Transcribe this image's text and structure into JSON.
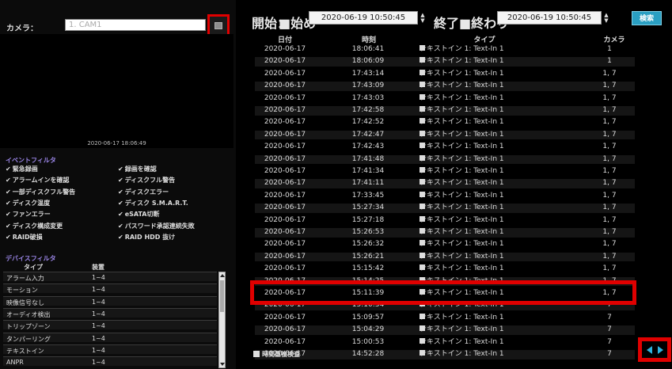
{
  "camera": {
    "label": "カメラ：",
    "value": "1. CAM1"
  },
  "video": {
    "timestamp": "2020-06-17  18:06:49"
  },
  "event_filter": {
    "title": "イベントフィルタ",
    "items": [
      "緊急録画",
      "録画を確認",
      "アラームインを確認",
      "ディスクフル警告",
      "一部ディスクフル警告",
      "ディスクエラー",
      "ディスク温度",
      "ディスク S.M.A.R.T.",
      "ファンエラー",
      "eSATA切断",
      "ディスク構成変更",
      "パスワード承認連続失敗",
      "RAID破損",
      "RAID HDD 抜け"
    ]
  },
  "device_filter": {
    "title": "デバイスフィルタ",
    "columns": [
      "タイプ",
      "装置"
    ],
    "rows": [
      [
        "アラーム入力",
        "1~4"
      ],
      [
        "モーション",
        "1~4"
      ],
      [
        "映像信号なし",
        "1~4"
      ],
      [
        "オーディオ検出",
        "1~4"
      ],
      [
        "トリップゾーン",
        "1~4"
      ],
      [
        "タンパーリング",
        "1~4"
      ],
      [
        "テキストイン",
        "1~4"
      ],
      [
        "ANPR",
        "1~4"
      ]
    ]
  },
  "toolbar": {
    "start_label": "開始：",
    "start_begin": "■始め",
    "start_value": "2020-06-19  10:50:45",
    "end_label": "終了：",
    "end_end": "■終わり",
    "end_value": "2020-06-19  10:50:45",
    "search_label": "検索"
  },
  "log": {
    "columns": [
      "日付",
      "時刻",
      "タイプ",
      "カメラ"
    ],
    "rows": [
      [
        "2020-06-17",
        "18:06:41",
        "テキストイン 1: Text-In 1",
        "1"
      ],
      [
        "2020-06-17",
        "18:06:09",
        "テキストイン 1: Text-In 1",
        "1"
      ],
      [
        "2020-06-17",
        "17:43:14",
        "テキストイン 1: Text-In 1",
        "1, 7"
      ],
      [
        "2020-06-17",
        "17:43:09",
        "テキストイン 1: Text-In 1",
        "1, 7"
      ],
      [
        "2020-06-17",
        "17:43:03",
        "テキストイン 1: Text-In 1",
        "1, 7"
      ],
      [
        "2020-06-17",
        "17:42:58",
        "テキストイン 1: Text-In 1",
        "1, 7"
      ],
      [
        "2020-06-17",
        "17:42:52",
        "テキストイン 1: Text-In 1",
        "1, 7"
      ],
      [
        "2020-06-17",
        "17:42:47",
        "テキストイン 1: Text-In 1",
        "1, 7"
      ],
      [
        "2020-06-17",
        "17:42:43",
        "テキストイン 1: Text-In 1",
        "1, 7"
      ],
      [
        "2020-06-17",
        "17:41:48",
        "テキストイン 1: Text-In 1",
        "1, 7"
      ],
      [
        "2020-06-17",
        "17:41:34",
        "テキストイン 1: Text-In 1",
        "1, 7"
      ],
      [
        "2020-06-17",
        "17:41:11",
        "テキストイン 1: Text-In 1",
        "1, 7"
      ],
      [
        "2020-06-17",
        "17:33:45",
        "テキストイン 1: Text-In 1",
        "1, 7"
      ],
      [
        "2020-06-17",
        "15:27:34",
        "テキストイン 1: Text-In 1",
        "1, 7"
      ],
      [
        "2020-06-17",
        "15:27:18",
        "テキストイン 1: Text-In 1",
        "1, 7"
      ],
      [
        "2020-06-17",
        "15:26:53",
        "テキストイン 1: Text-In 1",
        "1, 7"
      ],
      [
        "2020-06-17",
        "15:26:32",
        "テキストイン 1: Text-In 1",
        "1, 7"
      ],
      [
        "2020-06-17",
        "15:26:21",
        "テキストイン 1: Text-In 1",
        "1, 7"
      ],
      [
        "2020-06-17",
        "15:15:42",
        "テキストイン 1: Text-In 1",
        "1, 7"
      ],
      [
        "2020-06-17",
        "15:14:25",
        "テキストイン 1: Text-In 1",
        "1, 7"
      ],
      [
        "2020-06-17",
        "15:11:39",
        "テキストイン 1: Text-In 1",
        "1, 7"
      ],
      [
        "2020-06-17",
        "15:10:34",
        "テキストイン 1: Text-In 1",
        "7"
      ],
      [
        "2020-06-17",
        "15:09:57",
        "テキストイン 1: Text-In 1",
        "7"
      ],
      [
        "2020-06-17",
        "15:04:29",
        "テキストイン 1: Text-In 1",
        "7"
      ],
      [
        "2020-06-17",
        "15:00:53",
        "テキストイン 1: Text-In 1",
        "7"
      ],
      [
        "2020-06-17",
        "14:52:28",
        "テキストイン 1: Text-In 1",
        "7"
      ]
    ]
  },
  "footer": {
    "check_label": "時間重複検査"
  },
  "colors": {
    "highlight": "#e00000",
    "accent": "#2a9fc2",
    "section_title": "#9a85e6"
  }
}
